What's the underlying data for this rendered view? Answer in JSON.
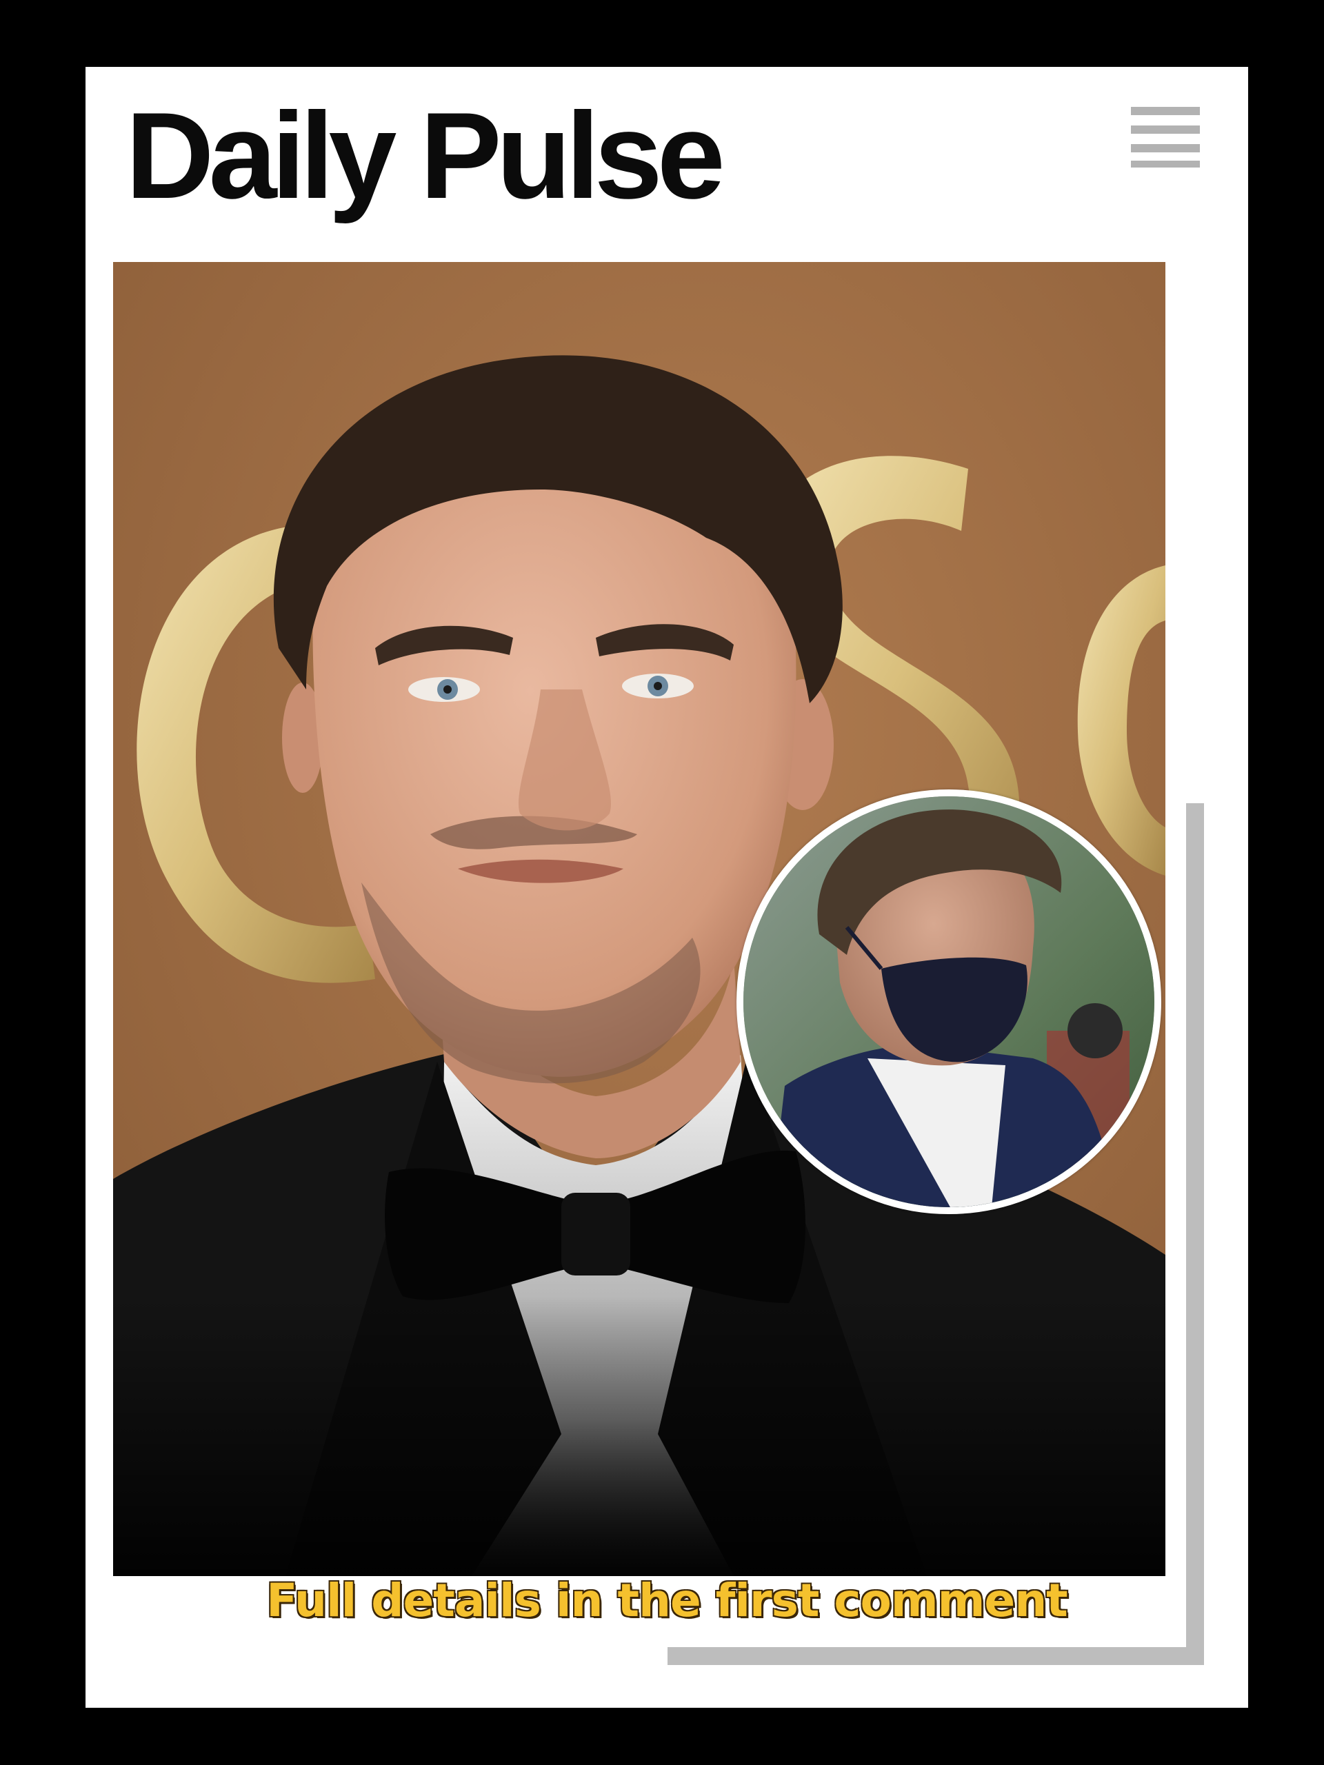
{
  "header": {
    "brand": "Daily Pulse",
    "menu_icon": "hamburger-menu-icon"
  },
  "hero": {
    "background_letters": "OSC",
    "inset_photo": "circular-inset-photo"
  },
  "caption": {
    "cta_text": "Full details in the first comment"
  },
  "colors": {
    "page_background": "#000000",
    "card_background": "#ffffff",
    "brand_text": "#0b0b0b",
    "menu_icon": "#b2b2b2",
    "cta_fill": "#f5c12e",
    "cta_outline": "#3a2608",
    "hero_backdrop": "#9e6e45",
    "decorative_frame": "#bdbdbd"
  }
}
